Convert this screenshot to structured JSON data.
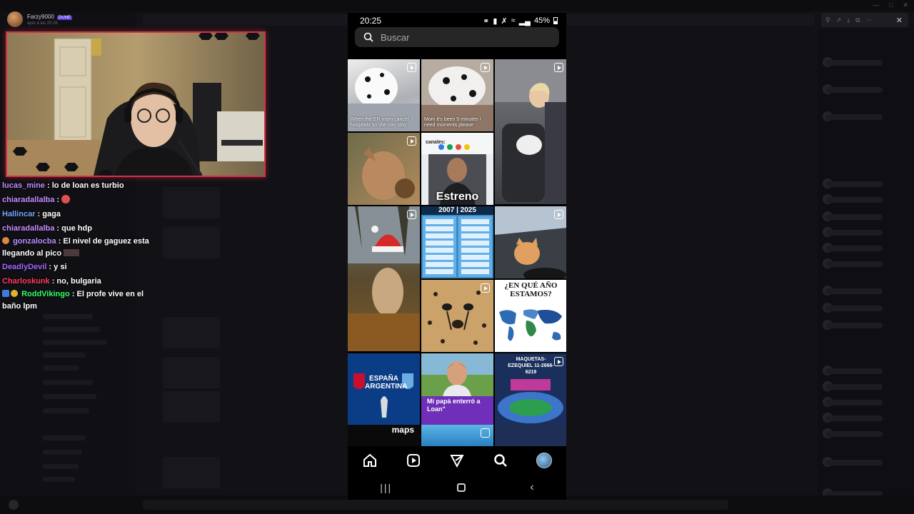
{
  "stream": {
    "streamer_name": "Farzy9000",
    "streamer_badge": "DUNE",
    "stream_time": "ayer a las 20:26"
  },
  "chat": {
    "messages": [
      {
        "user": "lucas_mine",
        "color": "#b98cff",
        "text": "lo de loan es turbio"
      },
      {
        "user": "chiaradallalba",
        "color": "#c98cff",
        "text": "",
        "emote": "devil-emoji"
      },
      {
        "user": "Hallincar",
        "color": "#6ea8ff",
        "text": "gaga"
      },
      {
        "user": "chiaradallalba",
        "color": "#c98cff",
        "text": "que hdp"
      },
      {
        "user": "gonzalocba",
        "color": "#b98cff",
        "text": "El nivel de gaguez esta llegando al pico",
        "badge": "orange"
      },
      {
        "user": "DeadlyDevil",
        "color": "#a066ff",
        "text": "y si"
      },
      {
        "user": "Charloskunk",
        "color": "#ff3b5c",
        "text": "no, bulgaria"
      },
      {
        "user": "RoddVikingo",
        "color": "#35ff68",
        "text": "El profe vive en el baño lpm",
        "badge": "blue"
      }
    ]
  },
  "phone": {
    "status": {
      "time": "20:25",
      "battery": "45%"
    },
    "search": {
      "placeholder": "Buscar"
    },
    "tiles": [
      {
        "caption": "When the ER mom cancel hospitals so she can stay",
        "reel": true,
        "bg": "#c7c8cc"
      },
      {
        "caption": "Mom it's been 5 minutes i need moments please",
        "reel": true,
        "bg": "#b9b3ac"
      },
      {
        "caption": "",
        "reel": true,
        "bg": "#6e6e72",
        "tall": true
      },
      {
        "caption": "",
        "reel": true,
        "bg": "#8a6b45"
      },
      {
        "caption": "Estreno",
        "reel": false,
        "bg": "#d9dde6",
        "header": "canales:"
      },
      {
        "caption": "",
        "reel": false,
        "bg": "#7a6a40",
        "tall": true
      },
      {
        "caption": "2007 | 2025",
        "reel": false,
        "bg": "#3f88c7"
      },
      {
        "caption": "",
        "reel": true,
        "bg": "#556272"
      },
      {
        "caption": "",
        "reel": true,
        "bg": "#b08a55"
      },
      {
        "caption": "¿EN QUÉ AÑO ESTAMOS?",
        "reel": false,
        "bg": "#ffffff"
      },
      {
        "caption": "ESPAÑA ARGENTINA",
        "reel": false,
        "bg": "#0a3f8c"
      },
      {
        "caption": "Mi papá enterró a Loan\"",
        "reel": false,
        "bg": "#6f2fb8"
      },
      {
        "caption": "MAQUETAS-EZEQUIEL 11-2666-6219",
        "reel": true,
        "bg": "#1f3f7a"
      }
    ],
    "bottom_tiles": [
      {
        "caption": "maps",
        "bg": "#0a0a0a"
      },
      {
        "caption": "",
        "bg": "#3aa0d8"
      },
      {
        "caption": "",
        "bg": "#1e2e55"
      }
    ],
    "nav": [
      "home-icon",
      "reels-icon",
      "send-icon",
      "search-icon",
      "profile-avatar"
    ],
    "sysnav": [
      "recents-button",
      "home-button",
      "back-button"
    ]
  },
  "background_app": {
    "right_toolbar_icons": [
      "zoom-icon",
      "share-icon",
      "download-icon",
      "external-icon",
      "more-icon",
      "close-icon"
    ]
  }
}
